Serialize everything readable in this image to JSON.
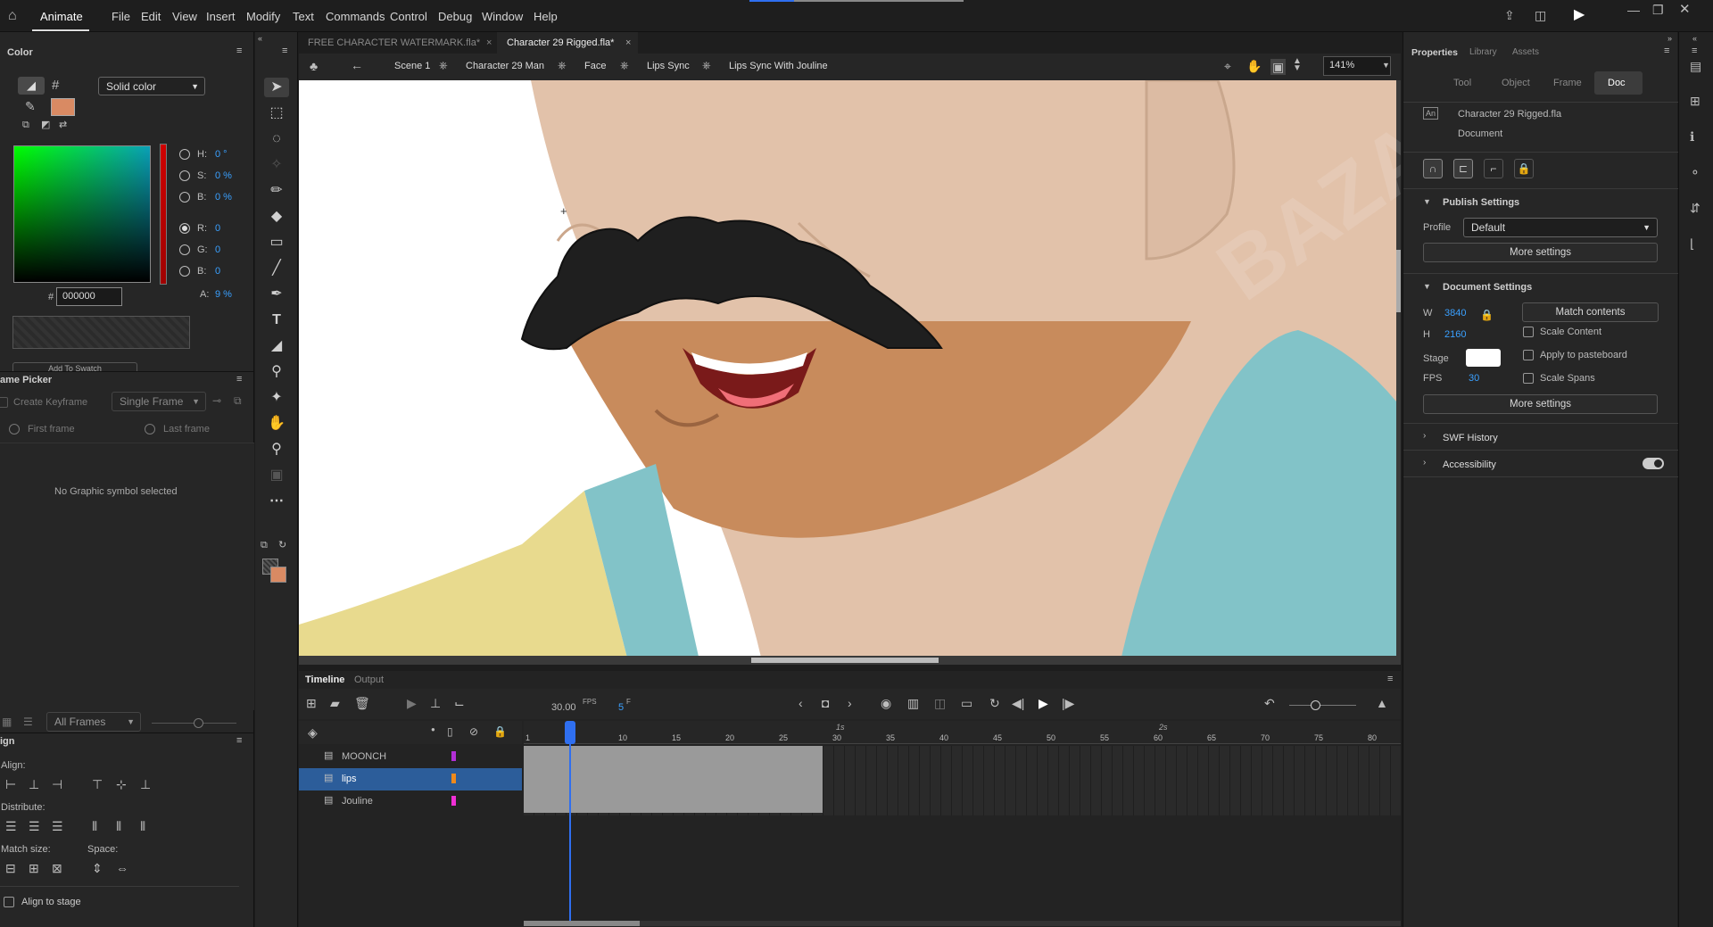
{
  "menubar": {
    "app_label": "Animate",
    "items": [
      "File",
      "Edit",
      "View",
      "Insert",
      "Modify",
      "Text",
      "Commands",
      "Control",
      "Debug",
      "Window",
      "Help"
    ]
  },
  "doc_tabs": [
    "FREE CHARACTER WATERMARK.fla*",
    "Character 29 Rigged.fla*"
  ],
  "breadcrumb": [
    "Scene 1",
    "Character 29 Man",
    "Face",
    "Lips Sync",
    "Lips Sync With Jouline"
  ],
  "zoom": "141%",
  "color_panel": {
    "title": "Color",
    "fill_type": "Solid color",
    "hsb": [
      {
        "k": "H:",
        "v": "0 °"
      },
      {
        "k": "S:",
        "v": "0 %"
      },
      {
        "k": "B:",
        "v": "0 %"
      }
    ],
    "rgb": [
      {
        "k": "R:",
        "v": "0"
      },
      {
        "k": "G:",
        "v": "0"
      },
      {
        "k": "B:",
        "v": "0"
      }
    ],
    "hex": "000000",
    "alpha_label": "A:",
    "alpha": "9 %",
    "hash": "#",
    "add_swatch": "Add To Swatch"
  },
  "frame_picker": {
    "title": "ame Picker",
    "create_keyframe": "Create Keyframe",
    "mode": "Single Frame",
    "first_frame": "First frame",
    "last_frame": "Last frame",
    "empty": "No Graphic symbol selected",
    "all_frames": "All Frames"
  },
  "align": {
    "title": "ign",
    "align_label": "Align:",
    "distribute_label": "Distribute:",
    "match_size_label": "Match size:",
    "space_label": "Space:",
    "align_to_stage": "Align to stage"
  },
  "right_panel": {
    "tabs": [
      "Properties",
      "Library",
      "Assets"
    ],
    "subtabs": [
      "Tool",
      "Object",
      "Frame",
      "Doc"
    ],
    "doc_name": "Character 29 Rigged.fla",
    "doc_type": "Document",
    "publish_settings": "Publish Settings",
    "profile_label": "Profile",
    "profile": "Default",
    "more_settings": "More settings",
    "document_settings": "Document Settings",
    "w_label": "W",
    "w": "3840",
    "h_label": "H",
    "h": "2160",
    "match_contents": "Match contents",
    "scale_content": "Scale Content",
    "stage_label": "Stage",
    "apply_pasteboard": "Apply to pasteboard",
    "fps_label": "FPS",
    "fps": "30",
    "scale_spans": "Scale Spans",
    "more_settings2": "More settings",
    "swf_history": "SWF History",
    "accessibility": "Accessibility"
  },
  "timeline": {
    "tabs": [
      "Timeline",
      "Output"
    ],
    "fps": "30.00",
    "fps_unit": "FPS",
    "frame": "5",
    "frame_unit": "F",
    "layers": [
      {
        "name": "MOONCH",
        "color": "#b22fd6"
      },
      {
        "name": "lips",
        "color": "#f08a1b"
      },
      {
        "name": "Jouline",
        "color": "#f02fd6"
      }
    ],
    "ruler": [
      "1",
      "5",
      "10",
      "15",
      "20",
      "25",
      "30",
      "35",
      "40",
      "45",
      "50",
      "55",
      "60",
      "65",
      "70",
      "75",
      "80"
    ],
    "sec_marks": [
      "1s",
      "2s"
    ]
  },
  "colors": {
    "accent": "#2f6ff0",
    "stroke_swatch": "#d98a63",
    "highlight_row": "#2c5d9a"
  }
}
